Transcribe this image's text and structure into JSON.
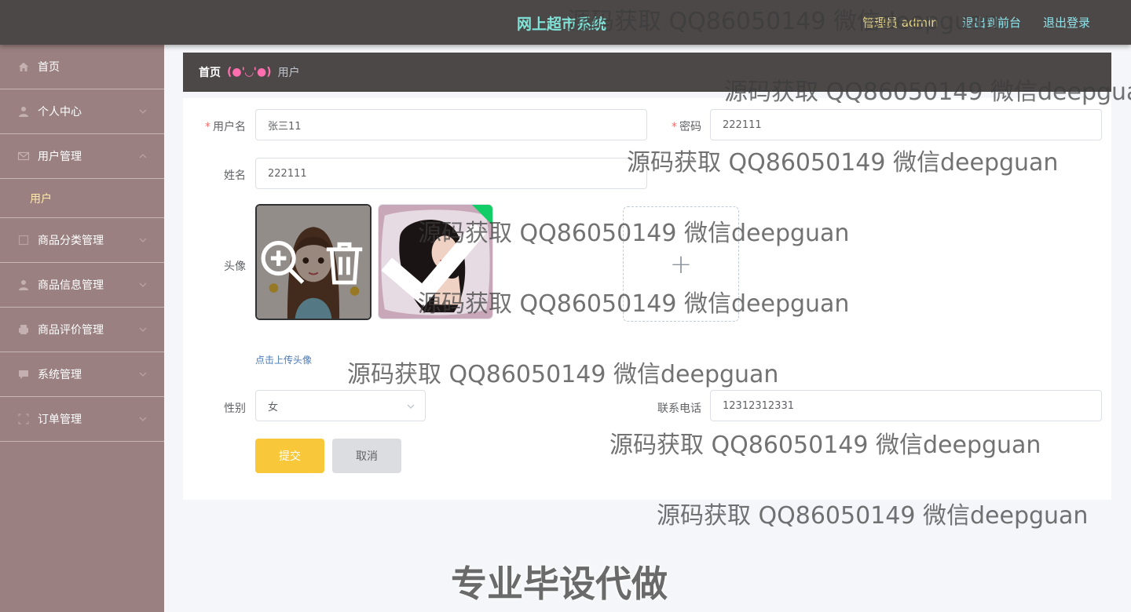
{
  "header": {
    "app_title": "网上超市系统",
    "admin_label": "管理员 admin",
    "front_link": "退出到前台",
    "logout_link": "退出登录"
  },
  "sidebar": {
    "items": [
      {
        "label": "首页",
        "icon": "home-icon"
      },
      {
        "label": "个人中心",
        "icon": "user-icon"
      },
      {
        "label": "用户管理",
        "icon": "mail-icon"
      },
      {
        "label": "商品分类管理",
        "icon": "square-icon"
      },
      {
        "label": "商品信息管理",
        "icon": "user-icon"
      },
      {
        "label": "商品评价管理",
        "icon": "printer-icon"
      },
      {
        "label": "系统管理",
        "icon": "chat-icon"
      },
      {
        "label": "订单管理",
        "icon": "frame-icon"
      }
    ],
    "subitem": "用户"
  },
  "breadcrumb": {
    "home": "首页",
    "separator": "(●'◡'●)",
    "current": "用户"
  },
  "form": {
    "username": {
      "label": "用户名",
      "value": "张三11"
    },
    "password": {
      "label": "密码",
      "value": "222111"
    },
    "name": {
      "label": "姓名",
      "value": "222111"
    },
    "avatar": {
      "label": "头像",
      "tip": "点击上传头像"
    },
    "gender": {
      "label": "性别",
      "value": "女"
    },
    "phone": {
      "label": "联系电话",
      "value": "12312312331"
    },
    "submit": "提交",
    "cancel": "取消"
  },
  "watermarks": [
    "源码获取 QQ86050149 微信deepguan",
    "源码获取 QQ86050149 微信deepgua",
    "源码获取 QQ86050149 微信deepguan",
    "源码获取 QQ86050149 微信deepguan",
    "源码获取 QQ86050149 微信deepguan",
    "源码获取 QQ86050149 微信deepguan",
    "源码获取 QQ86050149 微信deepguan",
    "源码获取 QQ86050149 微信deepguan"
  ],
  "promo": "专业毕设代做",
  "colors": {
    "topbar": "#4d4848",
    "sidebar": "#9a8080",
    "title": "#7fe3d8",
    "accent_link": "#8ee3ea",
    "submit": "#f8c73a",
    "required": "#f56c6c"
  }
}
